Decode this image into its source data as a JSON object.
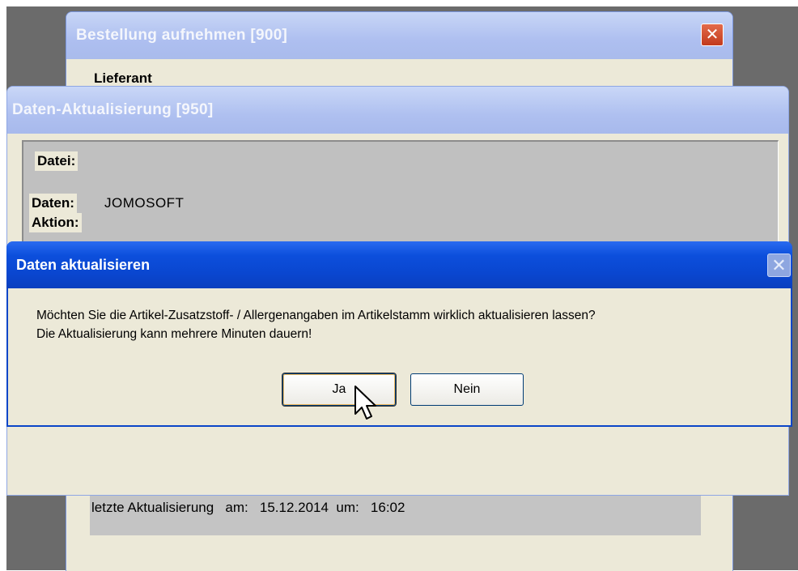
{
  "back_window": {
    "title": "Bestellung aufnehmen  [900]",
    "close_label": "✕",
    "lieferant_label": "Lieferant",
    "last_update_text": "letzte Aktualisierung   am:   15.12.2014  um:   16:02"
  },
  "middle_window": {
    "title": "Daten-Aktualisierung  [950]",
    "fields": {
      "datei_label": "Datei:",
      "datei_value": "",
      "daten_label": "Daten:",
      "daten_value": "JOMOSOFT",
      "aktion_label": "Aktion:"
    }
  },
  "dialog": {
    "title": "Daten aktualisieren",
    "close_label": "✕",
    "message_line1": "Möchten Sie die Artikel-Zusatzstoff- / Allergenangaben im Artikelstamm wirklich aktualisieren lassen?",
    "message_line2": "Die Aktualisierung kann mehrere Minuten dauern!",
    "yes_label": "Ja",
    "no_label": "Nein"
  },
  "colors": {
    "dialog_title": "#0a46cf",
    "inactive_title": "#aebff0",
    "window_bg": "#ece9d8",
    "panel_gray": "#c0c0c0"
  }
}
